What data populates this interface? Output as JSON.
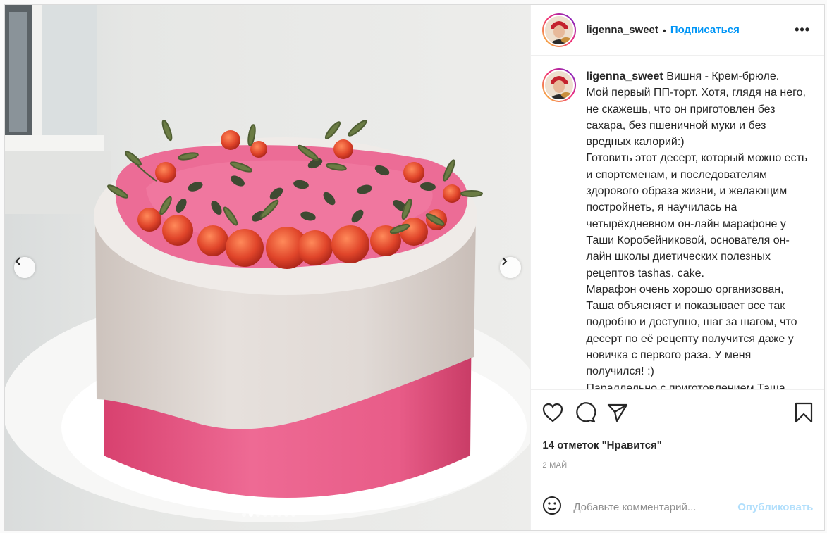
{
  "post": {
    "username": "ligenna_sweet",
    "separator": "•",
    "follow_label": "Подписаться",
    "more_label": "•••",
    "caption": "Вишня - Крем-брюле.\nМой первый ПП-торт. Хотя, глядя на него, не скажешь, что он приготовлен без сахара, без пшеничной муки и без вредных калорий:)\nГотовить этот десерт, который можно есть и спортсменам, и последователям здорового образа жизни, и желающим постройнеть, я научилась на четырёхдневном он-лайн марафоне у Таши Коробейниковой, основателя он-лайн школы диетических полезных рецептов tashas. cake.\nМарафон очень хорошо организован, Таша объясняет и показывает все так подробно и доступно, шаг за шагом, что десерт по её рецепту получится даже у новичка с первого раза. У меня получился! :)\nПараллельно с приготовлением Таша",
    "likes": "14 отметок \"Нравится\"",
    "date": "2 МАЙ",
    "comment_placeholder": "Добавьте комментарий...",
    "publish_label": "Опубликовать"
  },
  "carousel": {
    "total_slides": 8,
    "active_slide": 2
  },
  "icons": {
    "prev": "chevron-left-icon",
    "next": "chevron-right-icon",
    "like": "heart-icon",
    "comment": "comment-icon",
    "share": "paper-plane-icon",
    "save": "bookmark-icon",
    "emoji": "smile-icon"
  },
  "colors": {
    "link": "#0095f6",
    "publish_disabled": "#b2dffc",
    "muted": "#8e8e8e",
    "text": "#262626"
  }
}
